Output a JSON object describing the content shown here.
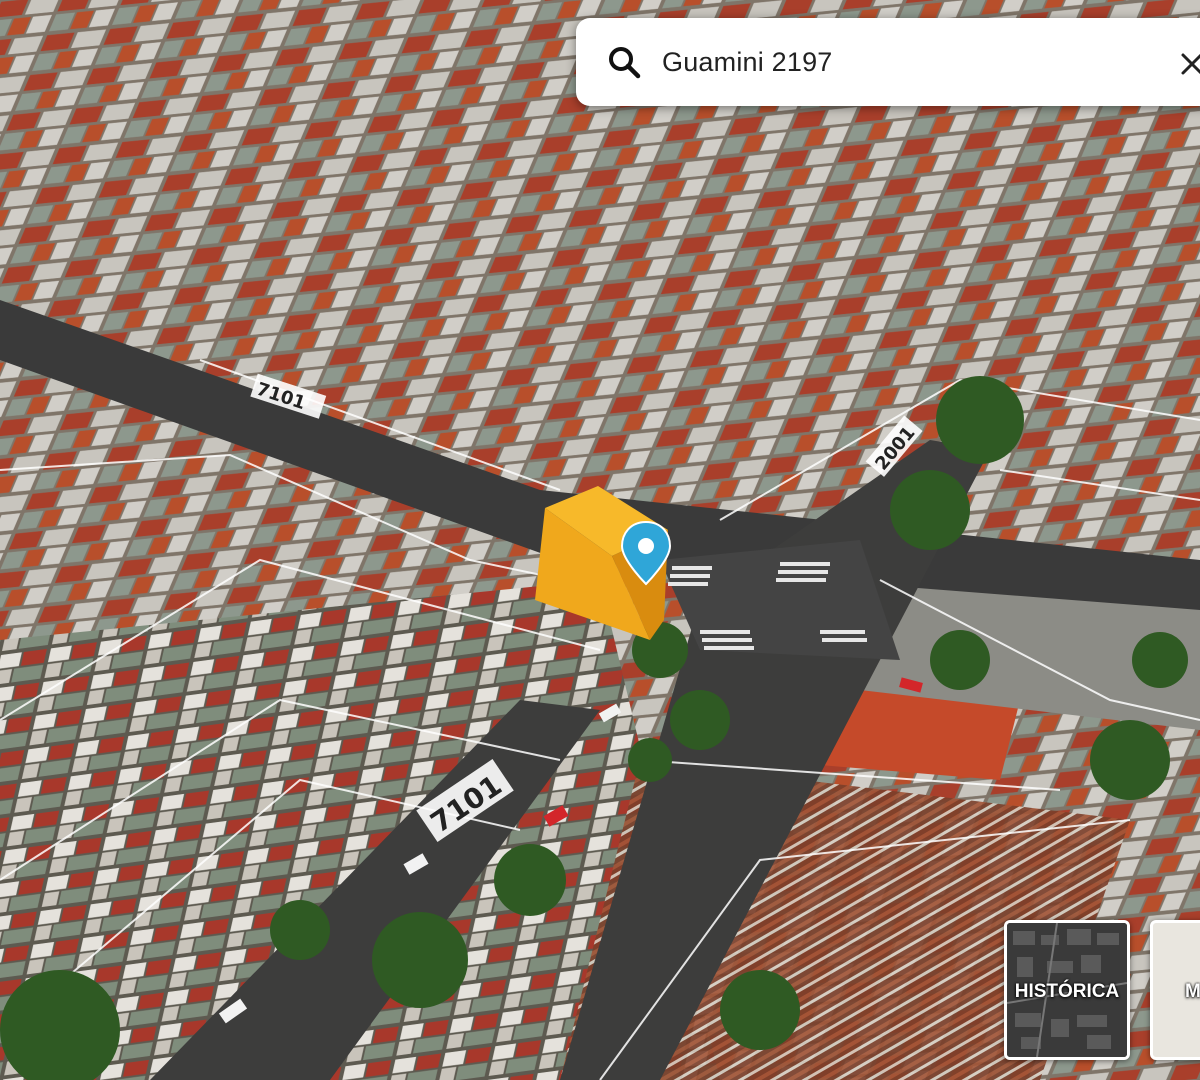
{
  "search": {
    "query": "Guamini 2197",
    "icon": "search-icon",
    "clear_icon": "close-icon"
  },
  "map": {
    "street_labels": [
      {
        "text": "7101"
      },
      {
        "text": "2001"
      },
      {
        "text": "7101"
      }
    ],
    "marker": {
      "icon": "location-pin-icon",
      "color": "#2fa6d8"
    },
    "highlighted_building_color": "#f0a81c"
  },
  "layers": {
    "historica_label": "HISTÓRICA",
    "map_label": "M"
  }
}
